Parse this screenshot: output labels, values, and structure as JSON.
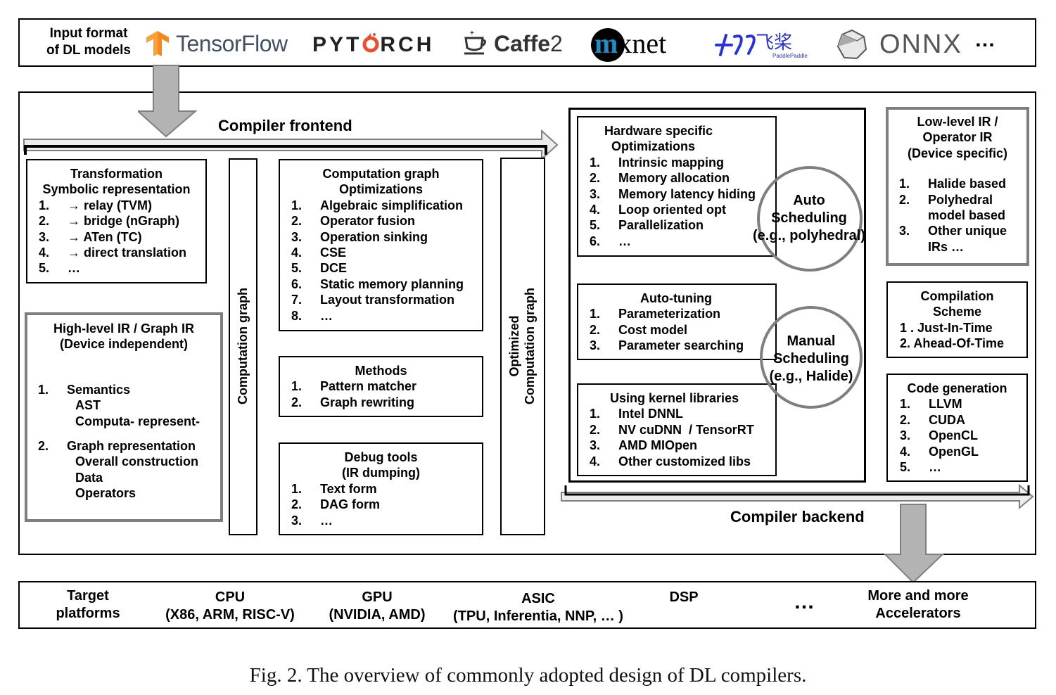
{
  "input_bar": {
    "label_line1": "Input format",
    "label_line2": "of DL models",
    "frameworks": [
      {
        "name": "TensorFlow",
        "icon": "tensorflow-logo"
      },
      {
        "name": "PYTORCH",
        "icon": "pytorch-logo"
      },
      {
        "name": "Caffe2",
        "icon": "caffe2-logo"
      },
      {
        "name": "mxnet",
        "icon": "mxnet-logo"
      },
      {
        "name": "飞桨",
        "sub": "PaddlePaddle",
        "icon": "paddlepaddle-logo"
      },
      {
        "name": "ONNX",
        "icon": "onnx-logo"
      }
    ],
    "more": "…"
  },
  "frontend": {
    "label": "Compiler frontend",
    "transformation": {
      "title1": "Transformation",
      "title2": "Symbolic representation",
      "items": [
        {
          "n": "1.",
          "t": "→ relay (TVM)"
        },
        {
          "n": "2.",
          "t": "→ bridge (nGraph)"
        },
        {
          "n": "3.",
          "t": "→ ATen (TC)"
        },
        {
          "n": "4.",
          "t": "→ direct translation"
        },
        {
          "n": "5.",
          "t": "…"
        }
      ]
    },
    "high_level_ir": {
      "title1": "High-level IR / Graph IR",
      "title2": "(Device independent)",
      "items": [
        {
          "n": "1.",
          "t": "Semantics",
          "sub": [
            "AST",
            "Computa-  represent-"
          ]
        },
        {
          "n": "2.",
          "t": "Graph representation",
          "sub": [
            "Overall construction",
            "Data",
            "Operators"
          ]
        }
      ]
    },
    "computation_graph_label": "Computation graph",
    "graph_optimizations": {
      "title1": "Computation graph",
      "title2": "Optimizations",
      "items": [
        {
          "n": "1.",
          "t": "Algebraic simplification"
        },
        {
          "n": "2.",
          "t": "Operator fusion"
        },
        {
          "n": "3.",
          "t": "Operation sinking"
        },
        {
          "n": "4.",
          "t": "CSE"
        },
        {
          "n": "5.",
          "t": "DCE"
        },
        {
          "n": "6.",
          "t": "Static memory planning"
        },
        {
          "n": "7.",
          "t": "Layout transformation"
        },
        {
          "n": "8.",
          "t": "…"
        }
      ]
    },
    "methods": {
      "title": "Methods",
      "items": [
        {
          "n": "1.",
          "t": "Pattern matcher"
        },
        {
          "n": "2.",
          "t": "Graph rewriting"
        }
      ]
    },
    "debug_tools": {
      "title1": "Debug tools",
      "title2": "(IR dumping)",
      "items": [
        {
          "n": "1.",
          "t": "Text form"
        },
        {
          "n": "2.",
          "t": "DAG form"
        },
        {
          "n": "3.",
          "t": "…"
        }
      ]
    },
    "optimized_graph_label1": "Optimized",
    "optimized_graph_label2": "Computation graph"
  },
  "backend": {
    "label": "Compiler backend",
    "hardware_opt": {
      "title1": "Hardware specific",
      "title2": "Optimizations",
      "items": [
        {
          "n": "1.",
          "t": "Intrinsic mapping"
        },
        {
          "n": "2.",
          "t": "Memory allocation"
        },
        {
          "n": "3.",
          "t": "Memory latency hiding"
        },
        {
          "n": "4.",
          "t": "Loop oriented opt"
        },
        {
          "n": "5.",
          "t": "Parallelization"
        },
        {
          "n": "6.",
          "t": "…"
        }
      ]
    },
    "auto_scheduling": [
      "Auto",
      "Scheduling",
      "(e.g., polyhedral)"
    ],
    "auto_tuning": {
      "title": "Auto-tuning",
      "items": [
        {
          "n": "1.",
          "t": "Parameterization"
        },
        {
          "n": "2.",
          "t": "Cost model"
        },
        {
          "n": "3.",
          "t": "Parameter searching"
        }
      ]
    },
    "manual_scheduling": [
      "Manual",
      "Scheduling",
      "(e.g., Halide)"
    ],
    "kernel_libs": {
      "title": "Using kernel libraries",
      "items": [
        {
          "n": "1.",
          "t": "Intel DNNL"
        },
        {
          "n": "2.",
          "t": "NV cuDNN  / TensorRT"
        },
        {
          "n": "3.",
          "t": "AMD MIOpen"
        },
        {
          "n": "4.",
          "t": "Other customized libs"
        }
      ]
    },
    "low_level_ir": {
      "title1": "Low-level IR /",
      "title2": "Operator IR",
      "title3": "(Device specific)",
      "items": [
        {
          "n": "1.",
          "t": "Halide based"
        },
        {
          "n": "2.",
          "t": "Polyhedral",
          "t2": "model based"
        },
        {
          "n": "3.",
          "t": "Other unique",
          "t2": "IRs …"
        }
      ]
    },
    "compilation_scheme": {
      "title1": "Compilation",
      "title2": "Scheme",
      "items": [
        "1 . Just-In-Time",
        "2. Ahead-Of-Time"
      ]
    },
    "code_generation": {
      "title": "Code generation",
      "items": [
        {
          "n": "1.",
          "t": "LLVM"
        },
        {
          "n": "2.",
          "t": "CUDA"
        },
        {
          "n": "3.",
          "t": "OpenCL"
        },
        {
          "n": "4.",
          "t": "OpenGL"
        },
        {
          "n": "5.",
          "t": "…"
        }
      ]
    }
  },
  "targets": {
    "label1": "Target",
    "label2": "platforms",
    "platforms": [
      {
        "l1": "CPU",
        "l2": "(X86, ARM, RISC-V)"
      },
      {
        "l1": "GPU",
        "l2": "(NVIDIA, AMD)"
      },
      {
        "l1": "ASIC",
        "l2": "(TPU, Inferentia, NNP, … )"
      },
      {
        "l1": "DSP",
        "l2": ""
      },
      {
        "l1": "…",
        "l2": ""
      },
      {
        "l1": "More and more",
        "l2": "Accelerators"
      }
    ]
  },
  "caption": "Fig. 2.  The overview of commonly adopted design of DL compilers.",
  "colors": {
    "arrow_fill": "#b3b3b3",
    "arrow_stroke": "#7f7f7f",
    "flow_fill": "#ececec",
    "tensorflow": "#f5891c",
    "pytorch_flame": "#ee4c2c",
    "mxnet_blue": "#1b8fc9",
    "paddle_blue": "#2932e1",
    "onnx_gray": "#555555"
  }
}
